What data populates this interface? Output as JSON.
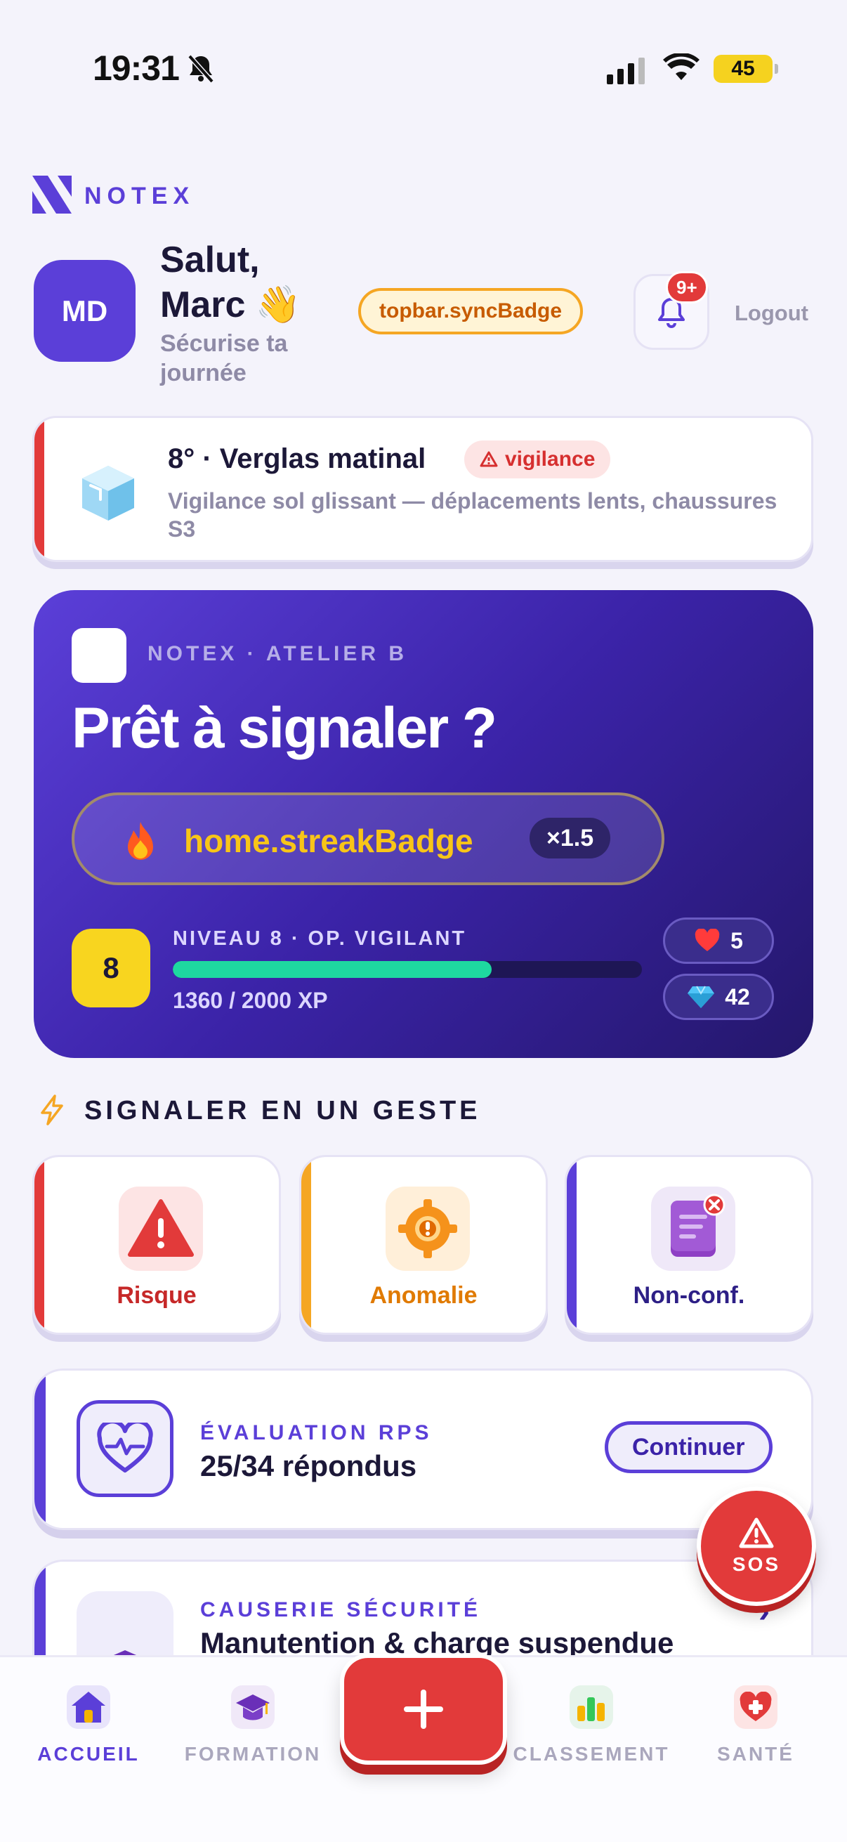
{
  "status_bar": {
    "time": "19:31",
    "battery": "45"
  },
  "brand": {
    "name": "NOTEX"
  },
  "header": {
    "avatar_initials": "MD",
    "greeting_line1": "Salut,",
    "greeting_line2": "Marc 👋",
    "subtitle_line1": "Sécurise ta",
    "subtitle_line2": "journée",
    "sync_badge": "topbar.syncBadge",
    "notification_count": "9+",
    "logout_label": "Logout"
  },
  "weather": {
    "title": "8° · Verglas matinal",
    "badge": "vigilance",
    "description": "Vigilance sol glissant — déplacements lents, chaussures S3",
    "accent": "#e23a3a"
  },
  "hero": {
    "tag": "NOTEX · ATELIER B",
    "title": "Prêt à signaler ?",
    "streak_label": "home.streakBadge",
    "multiplier": "×1.5",
    "level_number": "8",
    "level_label": "NIVEAU 8 · OP. VIGILANT",
    "xp_text": "1360 / 2000 XP",
    "xp_current": 1360,
    "xp_max": 2000,
    "hearts": "5",
    "gems": "42"
  },
  "quick_report": {
    "title": "SIGNALER EN UN GESTE",
    "items": [
      {
        "label": "Risque",
        "icon": "warning-icon",
        "color": "#d62f2f"
      },
      {
        "label": "Anomalie",
        "icon": "gear-alert-icon",
        "color": "#e07a00"
      },
      {
        "label": "Non-conf.",
        "icon": "document-x-icon",
        "color": "#3b23a8"
      }
    ]
  },
  "rps": {
    "kicker": "ÉVALUATION RPS",
    "title": "25/34 répondus",
    "button": "Continuer"
  },
  "talk": {
    "kicker": "CAUSERIE SÉCURITÉ",
    "title": "Manutention & charge suspendue"
  },
  "sos": {
    "label": "SOS"
  },
  "nav": {
    "items": [
      {
        "label": "ACCUEIL",
        "icon": "home-icon",
        "active": true
      },
      {
        "label": "FORMATION",
        "icon": "graduation-cap-icon",
        "active": false
      },
      {
        "label": "CLASSEMENT",
        "icon": "bar-chart-icon",
        "active": false
      },
      {
        "label": "SANTÉ",
        "icon": "health-cross-icon",
        "active": false
      }
    ],
    "fab_icon": "plus-icon"
  }
}
